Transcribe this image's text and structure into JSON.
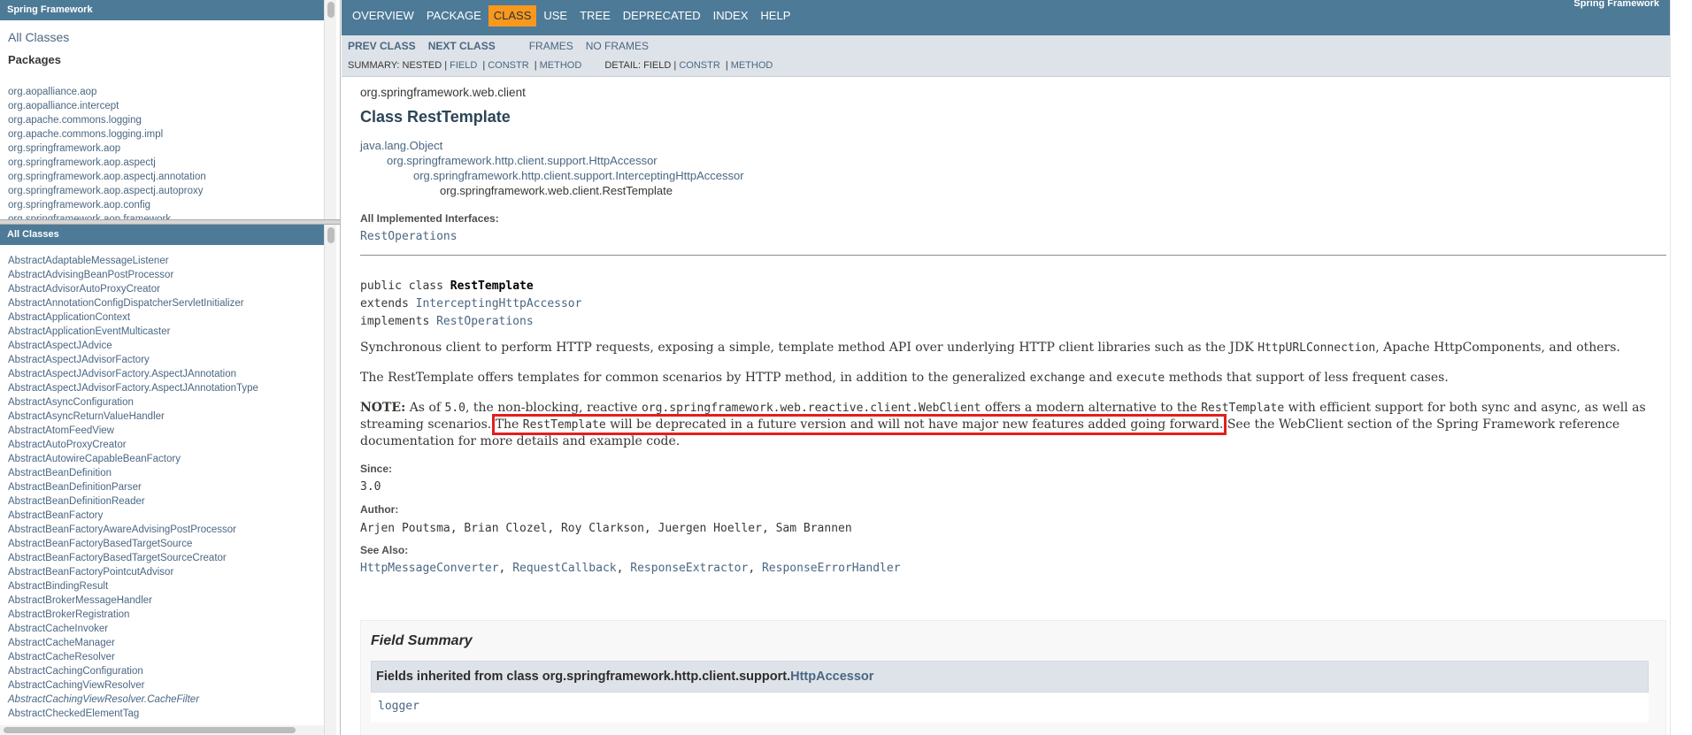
{
  "left": {
    "package_frame_title": "Spring Framework",
    "all_classes_link": "All Classes",
    "packages_heading": "Packages",
    "packages": [
      "org.aopalliance.aop",
      "org.aopalliance.intercept",
      "org.apache.commons.logging",
      "org.apache.commons.logging.impl",
      "org.springframework.aop",
      "org.springframework.aop.aspectj",
      "org.springframework.aop.aspectj.annotation",
      "org.springframework.aop.aspectj.autoproxy",
      "org.springframework.aop.config",
      "org.springframework.aop.framework"
    ],
    "class_frame_title": "All Classes",
    "classes": [
      {
        "name": "AbstractAdaptableMessageListener",
        "italic": false
      },
      {
        "name": "AbstractAdvisingBeanPostProcessor",
        "italic": false
      },
      {
        "name": "AbstractAdvisorAutoProxyCreator",
        "italic": false
      },
      {
        "name": "AbstractAnnotationConfigDispatcherServletInitializer",
        "italic": false
      },
      {
        "name": "AbstractApplicationContext",
        "italic": false
      },
      {
        "name": "AbstractApplicationEventMulticaster",
        "italic": false
      },
      {
        "name": "AbstractAspectJAdvice",
        "italic": false
      },
      {
        "name": "AbstractAspectJAdvisorFactory",
        "italic": false
      },
      {
        "name": "AbstractAspectJAdvisorFactory.AspectJAnnotation",
        "italic": false
      },
      {
        "name": "AbstractAspectJAdvisorFactory.AspectJAnnotationType",
        "italic": false
      },
      {
        "name": "AbstractAsyncConfiguration",
        "italic": false
      },
      {
        "name": "AbstractAsyncReturnValueHandler",
        "italic": false
      },
      {
        "name": "AbstractAtomFeedView",
        "italic": false
      },
      {
        "name": "AbstractAutoProxyCreator",
        "italic": false
      },
      {
        "name": "AbstractAutowireCapableBeanFactory",
        "italic": false
      },
      {
        "name": "AbstractBeanDefinition",
        "italic": false
      },
      {
        "name": "AbstractBeanDefinitionParser",
        "italic": false
      },
      {
        "name": "AbstractBeanDefinitionReader",
        "italic": false
      },
      {
        "name": "AbstractBeanFactory",
        "italic": false
      },
      {
        "name": "AbstractBeanFactoryAwareAdvisingPostProcessor",
        "italic": false
      },
      {
        "name": "AbstractBeanFactoryBasedTargetSource",
        "italic": false
      },
      {
        "name": "AbstractBeanFactoryBasedTargetSourceCreator",
        "italic": false
      },
      {
        "name": "AbstractBeanFactoryPointcutAdvisor",
        "italic": false
      },
      {
        "name": "AbstractBindingResult",
        "italic": false
      },
      {
        "name": "AbstractBrokerMessageHandler",
        "italic": false
      },
      {
        "name": "AbstractBrokerRegistration",
        "italic": false
      },
      {
        "name": "AbstractCacheInvoker",
        "italic": false
      },
      {
        "name": "AbstractCacheManager",
        "italic": false
      },
      {
        "name": "AbstractCacheResolver",
        "italic": false
      },
      {
        "name": "AbstractCachingConfiguration",
        "italic": false
      },
      {
        "name": "AbstractCachingViewResolver",
        "italic": false
      },
      {
        "name": "AbstractCachingViewResolver.CacheFilter",
        "italic": true
      },
      {
        "name": "AbstractCheckedElementTag",
        "italic": false
      }
    ]
  },
  "topnav": {
    "items": [
      "OVERVIEW",
      "PACKAGE",
      "CLASS",
      "USE",
      "TREE",
      "DEPRECATED",
      "INDEX",
      "HELP"
    ],
    "active_item": "CLASS",
    "about": "Spring Framework"
  },
  "subnav": {
    "prev_class": "PREV CLASS",
    "next_class": "NEXT CLASS",
    "frames": "FRAMES",
    "no_frames": "NO FRAMES",
    "summary_prefix": "SUMMARY: NESTED |",
    "summary_field": "FIELD",
    "summary_constr": "CONSTR",
    "summary_method": "METHOD",
    "detail_prefix": "DETAIL: FIELD |",
    "detail_constr": "CONSTR",
    "detail_method": "METHOD",
    "separator": "|"
  },
  "content": {
    "package_name": "org.springframework.web.client",
    "class_title": "Class RestTemplate",
    "inheritance": [
      "java.lang.Object",
      "org.springframework.http.client.support.HttpAccessor",
      "org.springframework.http.client.support.InterceptingHttpAccessor",
      "org.springframework.web.client.RestTemplate"
    ],
    "implemented_interfaces_label": "All Implemented Interfaces:",
    "implemented_interfaces": "RestOperations",
    "signature": {
      "line1_prefix": "public class ",
      "class_name": "RestTemplate",
      "extends_kw": "extends ",
      "extends_name": "InterceptingHttpAccessor",
      "implements_kw": "implements ",
      "implements_name": "RestOperations"
    },
    "para1": {
      "a": "Synchronous client to perform HTTP requests, exposing a simple, template method API over underlying HTTP client libraries such as the JDK ",
      "code1": "HttpURLConnection",
      "b": ", Apache HttpComponents, and others."
    },
    "para2": {
      "a": "The RestTemplate offers templates for common scenarios by HTTP method, in addition to the generalized ",
      "code1": "exchange",
      "b": " and ",
      "code2": "execute",
      "c": " methods that support of less frequent cases."
    },
    "note": {
      "label": "NOTE:",
      "a": " As of ",
      "code_version": "5.0",
      "b": ", the non-blocking, reactive ",
      "code_webclient": "org.springframework.web.reactive.client.WebClient",
      "c": " offers a modern alternative to the ",
      "code_rt": "RestTemplate",
      "d": " with efficient support for both sync and async, as well as streaming scenarios.",
      "hl_a": "The ",
      "hl_code": "RestTemplate",
      "hl_b": " will be deprecated in a future version and will not have major new features added going forward.",
      "e": " See the WebClient section of the Spring Framework reference documentation for more details and example code."
    },
    "since_label": "Since:",
    "since_value": "3.0",
    "author_label": "Author:",
    "author_value": "Arjen Poutsma, Brian Clozel, Roy Clarkson, Juergen Hoeller, Sam Brannen",
    "see_also_label": "See Also:",
    "see_also": [
      "HttpMessageConverter",
      "RequestCallback",
      "ResponseExtractor",
      "ResponseErrorHandler"
    ],
    "see_also_sep": ", ",
    "field_summary_title": "Field Summary",
    "fields_inherited_prefix": "Fields inherited from class org.springframework.http.client.support.",
    "fields_inherited_link": "HttpAccessor",
    "fields_inherited_value": "logger"
  },
  "colors": {
    "nav_bar": "#4d7a97",
    "active_tab": "#f8981d",
    "subnav_bg": "#dee3e9",
    "link": "#4a6782",
    "highlight_box": "#e41e1e"
  }
}
